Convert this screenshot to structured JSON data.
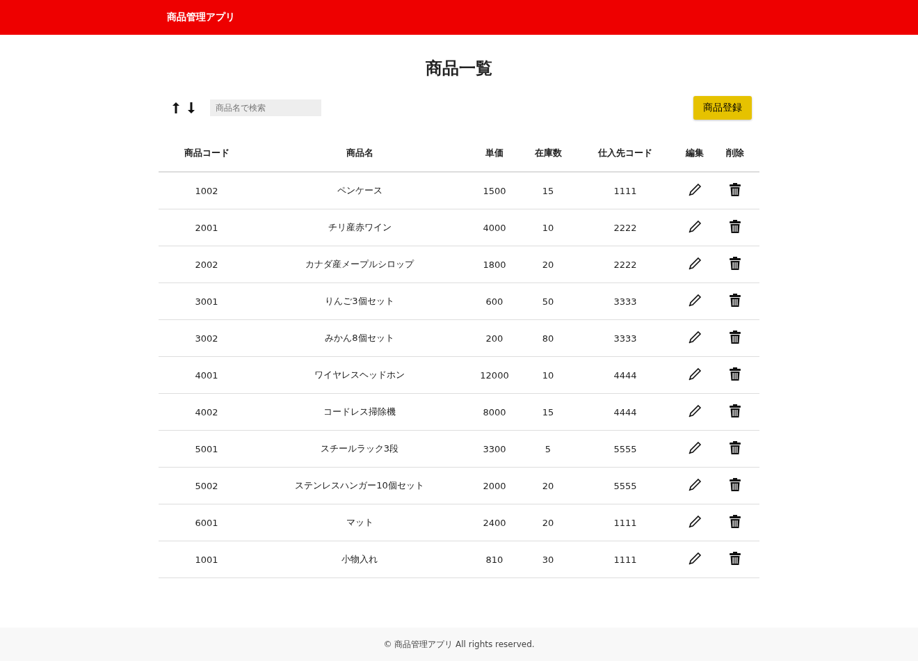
{
  "header": {
    "title": "商品管理アプリ"
  },
  "page_title": "商品一覧",
  "search": {
    "placeholder": "商品名で検索"
  },
  "register_button": "商品登録",
  "table": {
    "columns": [
      "商品コード",
      "商品名",
      "単価",
      "在庫数",
      "仕入先コード",
      "編集",
      "削除"
    ],
    "rows": [
      [
        "1002",
        "ペンケース",
        "1500",
        "15",
        "1111"
      ],
      [
        "2001",
        "チリ産赤ワイン",
        "4000",
        "10",
        "2222"
      ],
      [
        "2002",
        "カナダ産メープルシロップ",
        "1800",
        "20",
        "2222"
      ],
      [
        "3001",
        "りんご3個セット",
        "600",
        "50",
        "3333"
      ],
      [
        "3002",
        "みかん8個セット",
        "200",
        "80",
        "3333"
      ],
      [
        "4001",
        "ワイヤレスヘッドホン",
        "12000",
        "10",
        "4444"
      ],
      [
        "4002",
        "コードレス掃除機",
        "8000",
        "15",
        "4444"
      ],
      [
        "5001",
        "スチールラック3段",
        "3300",
        "5",
        "5555"
      ],
      [
        "5002",
        "ステンレスハンガー10個セット",
        "2000",
        "20",
        "5555"
      ],
      [
        "6001",
        "マット",
        "2400",
        "20",
        "1111"
      ],
      [
        "1001",
        "小物入れ",
        "810",
        "30",
        "1111"
      ]
    ]
  },
  "footer": "© 商品管理アプリ All rights reserved."
}
